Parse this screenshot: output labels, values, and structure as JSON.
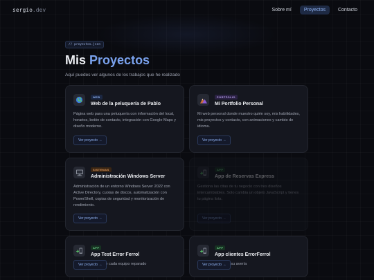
{
  "nav": {
    "brand_name": "sergio",
    "brand_tld": ".dev",
    "links": [
      {
        "label": "Sobre mí"
      },
      {
        "label": "Proyectos"
      },
      {
        "label": "Contacto"
      }
    ],
    "active_index": 1
  },
  "header": {
    "tag": "// proyectos.json",
    "title_part1": "Mis",
    "title_part2": "Proyectos",
    "subtitle": "Aquí puedes ver algunos de los trabajos que he realizado"
  },
  "projects": [
    {
      "icon": "globe-icon",
      "badge": "WEB",
      "title": "Web de la peluquería de Pablo",
      "description": "Página web para una peluquería con información del local, horarios, botón de contacto, integración con Google Maps y diseño moderno.",
      "button": "Ver proyecto →"
    },
    {
      "icon": "mountain-icon",
      "badge": "PORTFOLIO",
      "title": "Mi Portfolio Personal",
      "description": "Mi web personal donde muestro quién soy, mis habilidades, mis proyectos y contacto, con animaciones y cambio de idioma.",
      "button": "Ver proyecto →"
    },
    {
      "icon": "computer-icon",
      "badge": "SISTEMAS",
      "title": "Administración Windows Server",
      "description": "Administración de un entorno Windows Server 2022 con Active Directory, cuotas de discos, automatización con PowerShell, copias de seguridad y monitorización de rendimiento.",
      "button": "Ver proyecto →"
    },
    {
      "icon": "mobile-app-icon",
      "badge": "APP",
      "title": "App de Reservas Express",
      "description": "Gestiona las citas de tu negocio con tres diseños intercambiables. Solo cambia un objeto JavaScript y tienes tu página lista.",
      "button": "Ver proyecto →"
    },
    {
      "icon": "mobile-app-icon",
      "badge": "APP",
      "title": "App Test Error Ferrol",
      "description": "Gestiona los test de cada equipo reparado",
      "button": "Ver proyecto →"
    },
    {
      "icon": "mobile-app-icon",
      "badge": "APP",
      "title": "App clientes ErrorFerrol",
      "description": "Cada cliente cubre su avería",
      "button": "Ver proyecto →"
    }
  ],
  "colors": {
    "accent": "#7aa2ee",
    "background": "#0a0b10",
    "card": "#15171f"
  }
}
